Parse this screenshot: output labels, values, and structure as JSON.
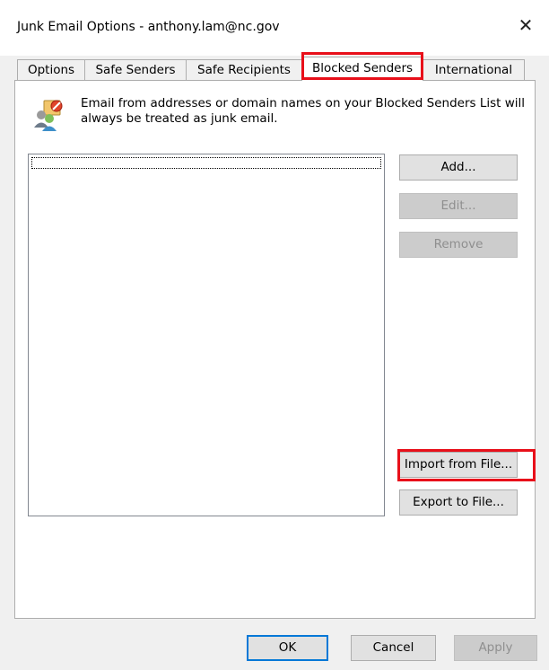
{
  "window": {
    "title": "Junk Email Options - anthony.lam@nc.gov",
    "close_icon": "close-icon"
  },
  "tabs": [
    {
      "label": "Options",
      "active": false
    },
    {
      "label": "Safe Senders",
      "active": false
    },
    {
      "label": "Safe Recipients",
      "active": false
    },
    {
      "label": "Blocked Senders",
      "active": true
    },
    {
      "label": "International",
      "active": false
    }
  ],
  "panel": {
    "icon": "blocked-senders-icon",
    "description": "Email from addresses or domain names on your Blocked Senders List will always be treated as junk email.",
    "list_items": []
  },
  "buttons": {
    "add": "Add...",
    "edit": "Edit...",
    "remove": "Remove",
    "import": "Import from File...",
    "export": "Export to File..."
  },
  "footer": {
    "ok": "OK",
    "cancel": "Cancel",
    "apply": "Apply"
  },
  "colors": {
    "highlight": "#e8101a",
    "default_button_border": "#0078d7"
  }
}
